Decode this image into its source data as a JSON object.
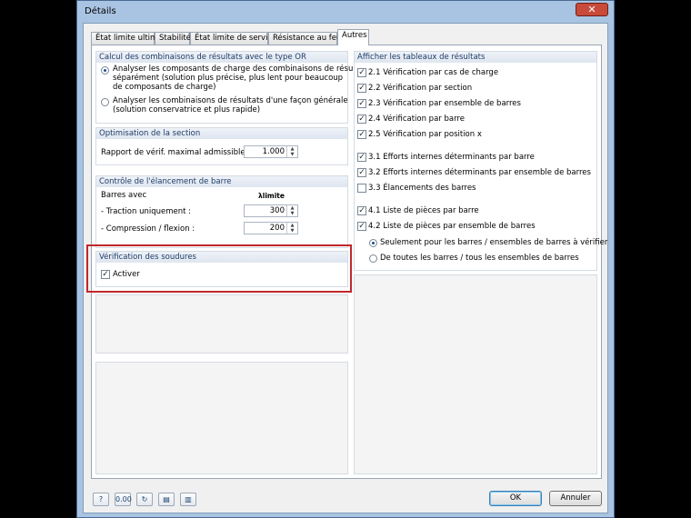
{
  "window": {
    "title": "Détails",
    "close_glyph": "✕"
  },
  "tabs": [
    {
      "label": "État limite ultime"
    },
    {
      "label": "Stabilité"
    },
    {
      "label": "État limite de service"
    },
    {
      "label": "Résistance au feu"
    },
    {
      "label": "Autres"
    }
  ],
  "active_tab": "Autres",
  "left": {
    "calc_group": {
      "title": "Calcul des combinaisons de résultats avec le type OR",
      "option1": [
        "Analyser les composants de charge des combinaisons de résultats",
        "séparément (solution plus précise, plus lent pour beaucoup",
        "de composants de charge)"
      ],
      "option2": [
        "Analyser les combinaisons de résultats d'une façon générale",
        "(solution conservatrice et plus rapide)"
      ],
      "selected": 1
    },
    "opt_group": {
      "title": "Optimisation de la section",
      "label": "Rapport de vérif. maximal admissible :",
      "value": "1.000"
    },
    "slender_group": {
      "title": "Contrôle de l'élancement de barre",
      "bars_label": "Barres avec",
      "col_header": "λlimite",
      "traction_label": "- Traction uniquement :",
      "traction_value": "300",
      "compression_label": "- Compression / flexion :",
      "compression_value": "200"
    },
    "weld_group": {
      "title": "Vérification des soudures",
      "activer_label": "Activer",
      "activer_checked": true
    }
  },
  "right": {
    "title": "Afficher les tableaux de résultats",
    "items": [
      {
        "label": "2.1 Vérification par cas de charge",
        "checked": true
      },
      {
        "label": "2.2 Vérification par section",
        "checked": true
      },
      {
        "label": "2.3 Vérification par ensemble de barres",
        "checked": true
      },
      {
        "label": "2.4 Vérification par barre",
        "checked": true
      },
      {
        "label": "2.5 Vérification par position x",
        "checked": true
      },
      {
        "label": "3.1 Efforts internes déterminants par barre",
        "checked": true
      },
      {
        "label": "3.2 Efforts internes déterminants par ensemble de barres",
        "checked": true
      },
      {
        "label": "3.3 Élancements des barres",
        "checked": false
      },
      {
        "label": "4.1 Liste de pièces par barre",
        "checked": true
      },
      {
        "label": "4.2 Liste de pièces par ensemble de barres",
        "checked": true
      }
    ],
    "radio1": "Seulement pour les barres / ensembles de barres à vérifier",
    "radio2": "De toutes les barres / tous les ensembles de barres",
    "radio_selected": 1
  },
  "footer": {
    "ok_label": "OK",
    "cancel_label": "Annuler"
  },
  "colors": {
    "highlight": "#c0282b",
    "group_title": "#1e3c66"
  }
}
